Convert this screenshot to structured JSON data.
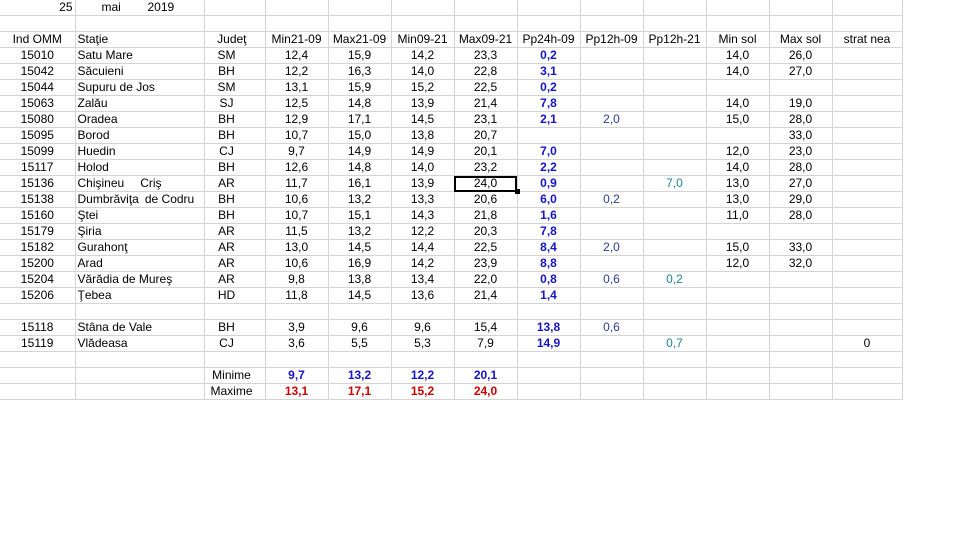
{
  "date": {
    "day": "25",
    "month": "mai",
    "year": "2019"
  },
  "headers": [
    "Ind OMM",
    "Staţie",
    "Judeţ",
    "Min21-09",
    "Max21-09",
    "Min09-21",
    "Max09-21",
    "Pp24h-09",
    "Pp12h-09",
    "Pp12h-21",
    "Min sol",
    "Max sol",
    "strat nea"
  ],
  "rows": [
    {
      "id": "15010",
      "name": "Satu Mare",
      "name2": "",
      "county": "SM",
      "min2109": "12,4",
      "max2109": "15,9",
      "min0921": "14,2",
      "max0921": "23,3",
      "pp24": "0,2",
      "pp12a": "",
      "pp12b": "",
      "minsol": "14,0",
      "maxsol": "26,0",
      "snow": ""
    },
    {
      "id": "15042",
      "name": "Săcuieni",
      "name2": "",
      "county": "BH",
      "min2109": "12,2",
      "max2109": "16,3",
      "min0921": "14,0",
      "max0921": "22,8",
      "pp24": "3,1",
      "pp12a": "",
      "pp12b": "",
      "minsol": "14,0",
      "maxsol": "27,0",
      "snow": ""
    },
    {
      "id": "15044",
      "name": "Supuru de Jos",
      "name2": "",
      "county": "SM",
      "min2109": "13,1",
      "max2109": "15,9",
      "min0921": "15,2",
      "max0921": "22,5",
      "pp24": "0,2",
      "pp12a": "",
      "pp12b": "",
      "minsol": "",
      "maxsol": "",
      "snow": ""
    },
    {
      "id": "15063",
      "name": "Zalău",
      "name2": "",
      "county": "SJ",
      "min2109": "12,5",
      "max2109": "14,8",
      "min0921": "13,9",
      "max0921": "21,4",
      "pp24": "7,8",
      "pp12a": "",
      "pp12b": "",
      "minsol": "14,0",
      "maxsol": "19,0",
      "snow": ""
    },
    {
      "id": "15080",
      "name": "Oradea",
      "name2": "",
      "county": "BH",
      "min2109": "12,9",
      "max2109": "17,1",
      "min0921": "14,5",
      "max0921": "23,1",
      "pp24": "2,1",
      "pp12a": "2,0",
      "pp12b": "",
      "minsol": "15,0",
      "maxsol": "28,0",
      "snow": ""
    },
    {
      "id": "15095",
      "name": "Borod",
      "name2": "",
      "county": "BH",
      "min2109": "10,7",
      "max2109": "15,0",
      "min0921": "13,8",
      "max0921": "20,7",
      "pp24": "",
      "pp12a": "",
      "pp12b": "",
      "minsol": "",
      "maxsol": "33,0",
      "snow": ""
    },
    {
      "id": "15099",
      "name": "Huedin",
      "name2": "",
      "county": "CJ",
      "min2109": "9,7",
      "max2109": "14,9",
      "min0921": "14,9",
      "max0921": "20,1",
      "pp24": "7,0",
      "pp12a": "",
      "pp12b": "",
      "minsol": "12,0",
      "maxsol": "23,0",
      "snow": ""
    },
    {
      "id": "15117",
      "name": "Holod",
      "name2": "",
      "county": "BH",
      "min2109": "12,6",
      "max2109": "14,8",
      "min0921": "14,0",
      "max0921": "23,2",
      "pp24": "2,2",
      "pp12a": "",
      "pp12b": "",
      "minsol": "14,0",
      "maxsol": "28,0",
      "snow": ""
    },
    {
      "id": "15136",
      "name": "Chişineu",
      "name2": "Criş",
      "county": "AR",
      "min2109": "11,7",
      "max2109": "16,1",
      "min0921": "13,9",
      "max0921": "24,0",
      "pp24": "0,9",
      "pp12a": "",
      "pp12b": "7,0",
      "minsol": "13,0",
      "maxsol": "27,0",
      "snow": ""
    },
    {
      "id": "15138",
      "name": "Dumbrăviţa",
      "name2": "de Codru",
      "county": "BH",
      "min2109": "10,6",
      "max2109": "13,2",
      "min0921": "13,3",
      "max0921": "20,6",
      "pp24": "6,0",
      "pp12a": "0,2",
      "pp12b": "",
      "minsol": "13,0",
      "maxsol": "29,0",
      "snow": ""
    },
    {
      "id": "15160",
      "name": "Ştei",
      "name2": "",
      "county": "BH",
      "min2109": "10,7",
      "max2109": "15,1",
      "min0921": "14,3",
      "max0921": "21,8",
      "pp24": "1,6",
      "pp12a": "",
      "pp12b": "",
      "minsol": "11,0",
      "maxsol": "28,0",
      "snow": ""
    },
    {
      "id": "15179",
      "name": "Şiria",
      "name2": "",
      "county": "AR",
      "min2109": "11,5",
      "max2109": "13,2",
      "min0921": "12,2",
      "max0921": "20,3",
      "pp24": "7,8",
      "pp12a": "",
      "pp12b": "",
      "minsol": "",
      "maxsol": "",
      "snow": ""
    },
    {
      "id": "15182",
      "name": "Gurahonţ",
      "name2": "",
      "county": "AR",
      "min2109": "13,0",
      "max2109": "14,5",
      "min0921": "14,4",
      "max0921": "22,5",
      "pp24": "8,4",
      "pp12a": "2,0",
      "pp12b": "",
      "minsol": "15,0",
      "maxsol": "33,0",
      "snow": ""
    },
    {
      "id": "15200",
      "name": "Arad",
      "name2": "",
      "county": "AR",
      "min2109": "10,6",
      "max2109": "16,9",
      "min0921": "14,2",
      "max0921": "23,9",
      "pp24": "8,8",
      "pp12a": "",
      "pp12b": "",
      "minsol": "12,0",
      "maxsol": "32,0",
      "snow": ""
    },
    {
      "id": "15204",
      "name": "Vărădia de Mureş",
      "name2": "",
      "county": "AR",
      "min2109": "9,8",
      "max2109": "13,8",
      "min0921": "13,4",
      "max0921": "22,0",
      "pp24": "0,8",
      "pp12a": "0,6",
      "pp12b": "0,2",
      "minsol": "",
      "maxsol": "",
      "snow": ""
    },
    {
      "id": "15206",
      "name": "Ţebea",
      "name2": "",
      "county": "HD",
      "min2109": "11,8",
      "max2109": "14,5",
      "min0921": "13,6",
      "max0921": "21,4",
      "pp24": "1,4",
      "pp12a": "",
      "pp12b": "",
      "minsol": "",
      "maxsol": "",
      "snow": ""
    }
  ],
  "mountain_rows": [
    {
      "id": "15118",
      "name": "Stâna de Vale",
      "name2": "",
      "county": "BH",
      "min2109": "3,9",
      "max2109": "9,6",
      "min0921": "9,6",
      "max0921": "15,4",
      "pp24": "13,8",
      "pp12a": "0,6",
      "pp12b": "",
      "minsol": "",
      "maxsol": "",
      "snow": ""
    },
    {
      "id": "15119",
      "name": "Vlădeasa",
      "name2": "",
      "county": "CJ",
      "min2109": "3,6",
      "max2109": "5,5",
      "min0921": "5,3",
      "max0921": "7,9",
      "pp24": "14,9",
      "pp12a": "",
      "pp12b": "0,7",
      "minsol": "",
      "maxsol": "",
      "snow": "0"
    }
  ],
  "summary": {
    "min_label": "Minime",
    "max_label": "Maxime",
    "min_vals": [
      "9,7",
      "13,2",
      "12,2",
      "20,1"
    ],
    "max_vals": [
      "13,1",
      "17,1",
      "15,2",
      "24,0"
    ]
  },
  "selected_cell": {
    "row": "15136",
    "col": "max0921"
  },
  "colors": {
    "blue": "#1414c8",
    "red": "#d00000",
    "navy": "#2a3a9a",
    "teal": "#1a8a8a",
    "gridline": "#d4d4d4"
  }
}
